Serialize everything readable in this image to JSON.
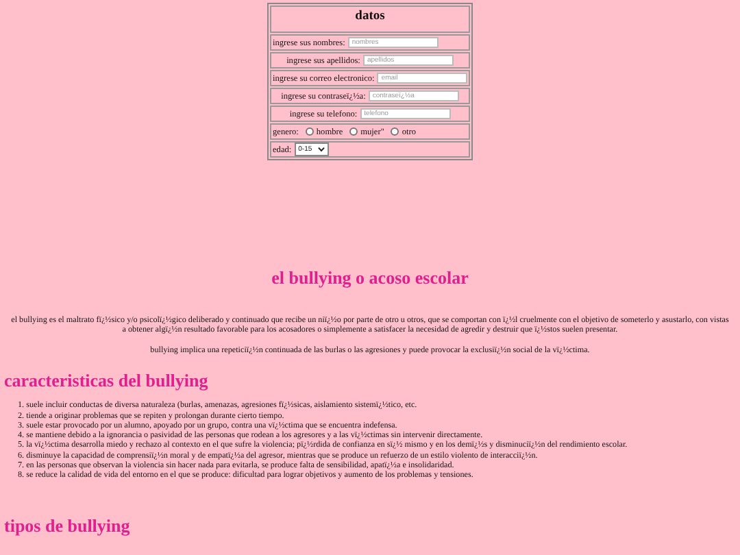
{
  "form": {
    "title": "datos",
    "fields": [
      {
        "label": "ingrese sus nombres:",
        "placeholder": "nombres"
      },
      {
        "label": "ingrese sus apellidos:",
        "placeholder": "apellidos"
      },
      {
        "label": "ingrese su correo electronico:",
        "placeholder": "email"
      },
      {
        "label": "ingrese su contraseï¿½a:",
        "placeholder": "contraseï¿½a"
      },
      {
        "label": "ingrese su telefono:",
        "placeholder": "telefono"
      }
    ],
    "gender": {
      "label": "genero:",
      "options": [
        {
          "label": "hombre",
          "selected": false
        },
        {
          "label": "mujer\"",
          "selected": false
        },
        {
          "label": "otro",
          "selected": false
        }
      ]
    },
    "age": {
      "label": "edad:",
      "value": "0-15"
    }
  },
  "heading": "el bullying o acoso escolar",
  "paragraphs": [
    "el bullying es el maltrato fï¿½sico y/o psicolï¿½gico deliberado y continuado que recibe un niï¿½o por parte de otro u otros, que se comportan con ï¿½l cruelmente con el objetivo de someterlo y asustarlo, con vistas a obtener algï¿½n resultado favorable para los acosadores o simplemente a satisfacer la necesidad de agredir y destruir que ï¿½stos suelen presentar.",
    "bullying implica una repeticiï¿½n continuada de las burlas o las agresiones y puede provocar la exclusiï¿½n social de la vï¿½ctima."
  ],
  "characteristics": {
    "title": "caracteristicas del bullying",
    "items": [
      "1. suele incluir conductas de diversa naturaleza (burlas, amenazas, agresiones fï¿½sicas, aislamiento sistemï¿½tico, etc.",
      "2. tiende a originar problemas que se repiten y prolongan durante cierto tiempo.",
      "3. suele estar provocado por un alumno, apoyado por un grupo, contra una vï¿½ctima que se encuentra indefensa.",
      "4. se mantiene debido a la ignorancia o pasividad de las personas que rodean a los agresores y a las vï¿½ctimas sin intervenir directamente.",
      "5. la vï¿½ctima desarrolla miedo y rechazo al contexto en el que sufre la violencia; pï¿½rdida de confianza en sï¿½ mismo y en los demï¿½s y disminuciï¿½n del rendimiento escolar.",
      "6. disminuye la capacidad de comprensiï¿½n moral y de empatï¿½a del agresor, mientras que se produce un refuerzo de un estilo violento de interacciï¿½n.",
      "7. en las personas que observan la violencia sin hacer nada para evitarla, se produce falta de sensibilidad, apatï¿½a e insolidaridad.",
      "8. se reduce la calidad de vida del entorno en el que se produce: dificultad para lograr objetivos y aumento de los problemas y tensiones."
    ]
  },
  "types_heading": "tipos de bullying"
}
